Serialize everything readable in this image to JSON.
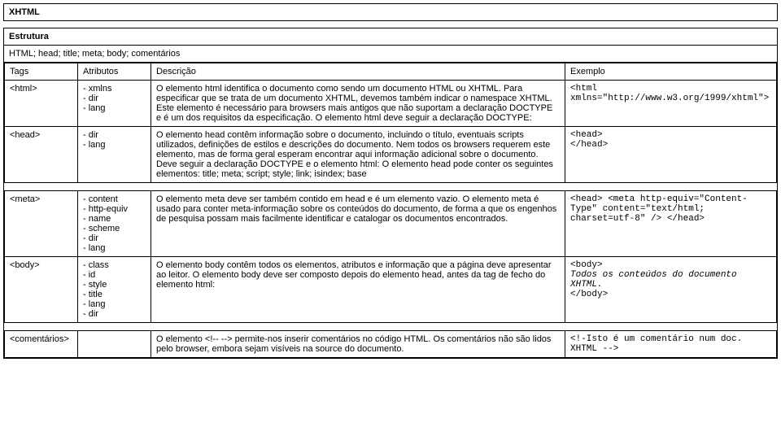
{
  "title": "XHTML",
  "section": "Estrutura",
  "subsection": "HTML; head; title; meta; body; comentários",
  "headers": {
    "tags": "Tags",
    "atributos": "Atributos",
    "descricao": "Descrição",
    "exemplo": "Exemplo"
  },
  "rows": [
    {
      "tag": "<html>",
      "attrs": [
        "- xmlns",
        "- dir",
        "- lang"
      ],
      "desc": "O elemento html identifica o documento como sendo um documento HTML ou XHTML. Para especificar que se trata de um documento XHTML, devemos também indicar o namespace XHTML. Este elemento é necessário para browsers mais antigos que não suportam a declaração DOCTYPE e é um dos requisitos da especificação. O elemento html deve seguir a declaração DOCTYPE:",
      "example": "<html\nxmlns=\"http://www.w3.org/1999/xhtml\">"
    },
    {
      "tag": "<head>",
      "attrs": [
        "- dir",
        "- lang"
      ],
      "desc": "O elemento head contêm informação sobre o documento, incluindo o título, eventuais scripts utilizados, definições de estilos e descrições do documento. Nem todos os browsers requerem este elemento, mas de forma geral esperam encontrar aqui informação adicional sobre o documento. Deve seguir a declaração DOCTYPE e o elemento html: O elemento head pode conter os seguintes elementos: title; meta; script; style; link; isindex; base",
      "example": "<head>\n</head>"
    },
    {
      "tag": "<meta>",
      "attrs": [
        "- content",
        "- http-equiv",
        "- name",
        "- scheme",
        "- dir",
        "- lang"
      ],
      "desc": "O elemento meta deve ser também contido em head e é um elemento vazio. O elemento meta é usado para conter meta-informação sobre os conteúdos do documento, de forma a que os engenhos de pesquisa possam mais facilmente identificar e catalogar os documentos encontrados.",
      "example": "<head> <meta http-equiv=\"Content-\nType\" content=\"text/html;\ncharset=utf-8\" /> </head>"
    },
    {
      "tag": "<body>",
      "attrs": [
        "- class",
        "- id",
        "- style",
        "- title",
        "- lang",
        "- dir"
      ],
      "desc": "O elemento body contêm todos os elementos, atributos e informação que a página deve apresentar ao leitor. O elemento body deve ser composto depois do elemento head, antes da tag de fecho do elemento html:",
      "example_lines": [
        {
          "text": "<body>",
          "ital": false
        },
        {
          "text": "Todos os conteúdos do documento XHTML.",
          "ital": true
        },
        {
          "text": "</body>",
          "ital": false
        }
      ]
    },
    {
      "tag": "<comentários>",
      "attrs": [],
      "desc": "O elemento <!-- --> permite-nos inserir comentários no código HTML. Os comentários não são lidos pelo browser, embora sejam visíveis na source do documento.",
      "example": "<!-Isto é um comentário num doc.\nXHTML -->"
    }
  ]
}
